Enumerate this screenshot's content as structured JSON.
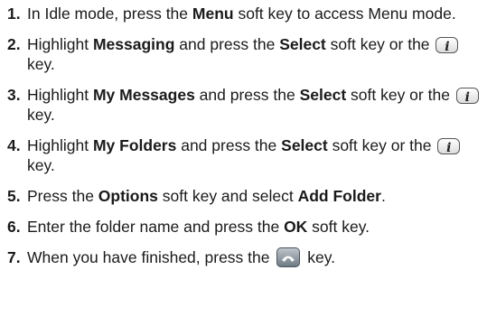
{
  "steps": [
    {
      "number": "1.",
      "segments": [
        {
          "t": "In Idle mode, press the "
        },
        {
          "t": "Menu",
          "bold": true
        },
        {
          "t": " soft key to access Menu mode."
        }
      ]
    },
    {
      "number": "2.",
      "segments": [
        {
          "t": "Highlight "
        },
        {
          "t": "Messaging",
          "bold": true
        },
        {
          "t": " and press the "
        },
        {
          "t": "Select",
          "bold": true
        },
        {
          "t": " soft key or the "
        },
        {
          "icon": "i-key-icon"
        },
        {
          "t": " key."
        }
      ]
    },
    {
      "number": "3.",
      "segments": [
        {
          "t": "Highlight "
        },
        {
          "t": "My Messages",
          "bold": true
        },
        {
          "t": " and press the "
        },
        {
          "t": "Select",
          "bold": true
        },
        {
          "t": " soft key or the "
        },
        {
          "icon": "i-key-icon"
        },
        {
          "t": " key."
        }
      ]
    },
    {
      "number": "4.",
      "segments": [
        {
          "t": "Highlight "
        },
        {
          "t": "My Folders",
          "bold": true
        },
        {
          "t": " and press the "
        },
        {
          "t": "Select",
          "bold": true
        },
        {
          "t": " soft key or the "
        },
        {
          "icon": "i-key-icon"
        },
        {
          "t": " key."
        }
      ]
    },
    {
      "number": "5.",
      "segments": [
        {
          "t": "Press the "
        },
        {
          "t": "Options",
          "bold": true
        },
        {
          "t": " soft key and select "
        },
        {
          "t": "Add Folder",
          "bold": true
        },
        {
          "t": "."
        }
      ]
    },
    {
      "number": "6.",
      "segments": [
        {
          "t": "Enter the folder name and press the "
        },
        {
          "t": "OK",
          "bold": true
        },
        {
          "t": " soft key."
        }
      ]
    },
    {
      "number": "7.",
      "segments": [
        {
          "t": "When you have finished, press the "
        },
        {
          "icon": "end-key-icon"
        },
        {
          "t": " key."
        }
      ]
    }
  ]
}
